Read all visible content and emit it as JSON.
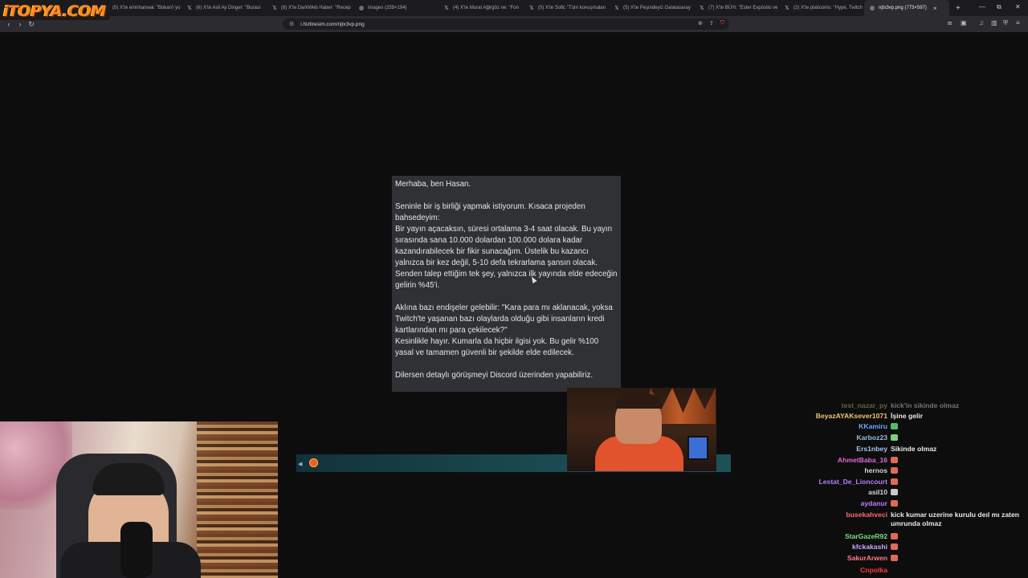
{
  "logo": {
    "text": "iTOPYA.COM"
  },
  "tabs": [
    {
      "label": "(5) X'te emirhanwai: \"Bokan'i yo",
      "icon": "x-logo-icon"
    },
    {
      "label": "(6) X'te Asli Ay Dinger: \"Burasi",
      "icon": "x-logo-icon"
    },
    {
      "label": "(6) X'te DarkWeb Haber: \"Recep",
      "icon": "x-logo-icon"
    },
    {
      "label": "images (259×194)",
      "icon": "globe-icon"
    },
    {
      "label": "(4) X'te Murat Ağirgöz ne: \"Fon",
      "icon": "x-logo-icon"
    },
    {
      "label": "(5) X'te Sofic \"Tüm konuşmaları",
      "icon": "x-logo-icon"
    },
    {
      "label": "(5) X'te Peşindeyiz Galatasaray",
      "icon": "x-logo-icon"
    },
    {
      "label": "(7) X'te BÜYi: \"Ester Expósito ve",
      "icon": "x-logo-icon"
    },
    {
      "label": "(2) X'te platicoms: \"Hype, Twitch",
      "icon": "x-logo-icon"
    },
    {
      "label": "njtx3vp.png (773×597)",
      "icon": "globe-icon",
      "active": true
    }
  ],
  "address": {
    "url": "i.hizliresim.com/njtx3vp.png"
  },
  "message_image": {
    "paragraphs": [
      "Merhaba, ben Hasan.",
      "Seninle bir iş birliği yapmak istiyorum. Kısaca projeden bahsedeyim:\nBir yayın açacaksın, süresi ortalama 3-4 saat olacak. Bu yayın sırasında sana 10.000 dolardan 100.000 dolara kadar kazandırabilecek bir fikir sunacağım. Üstelik bu kazancı yalnızca bir kez değil, 5-10 defa tekrarlama şansın olacak.\nSenden talep ettiğim tek şey, yalnızca ilk yayında elde edeceğin gelirin %45'i.",
      "Aklına bazı endişeler gelebilir: \"Kara para mı aklanacak, yoksa Twitch'te yaşanan bazı olaylarda olduğu gibi insanların kredi kartlarından mı para çekilecek?\"\nKesinlikle hayır. Kumarla da hiçbir ilgisi yok. Bu gelir %100 yasal ve tamamen güvenli bir şekilde elde edilecek.",
      "Dilersen detaylı görüşmeyi Discord üzerinden yapabiliriz."
    ]
  },
  "chat": [
    {
      "user": "test_nazar_py",
      "color": "#d6c27a",
      "msg": "kick'in sikinde olmaz"
    },
    {
      "user": "BeyazAYAKsever1071",
      "color": "#f0c674",
      "msg": "İşine gelir"
    },
    {
      "user": "KKamiru",
      "color": "#6ea8ff",
      "msg": "",
      "emote": "#4fbf6a"
    },
    {
      "user": "Karboz23",
      "color": "#9bb8d8",
      "msg": "",
      "emote": "#7bd07a"
    },
    {
      "user": "Ers1nbey",
      "color": "#a9c6e8",
      "msg": "Sikinde olmaz"
    },
    {
      "user": "AhmetBaba_16",
      "color": "#d96bd6",
      "msg": "",
      "emote": "#e06a5a"
    },
    {
      "user": "hernos",
      "color": "#d5d5d5",
      "msg": "",
      "emote": "#e06a5a"
    },
    {
      "user": "Lestat_De_Lioncourt",
      "color": "#b57cff",
      "msg": "",
      "emote": "#e06a5a"
    },
    {
      "user": "asil10",
      "color": "#d5d5d5",
      "msg": "",
      "emote": "#c9c9c9"
    },
    {
      "user": "aydanur",
      "color": "#c07cff",
      "msg": "",
      "emote": "#e06a5a"
    },
    {
      "user": "busekahveci",
      "color": "#ff6b6b",
      "msg": "kick kumar uzerine kurulu deıl mı zaten umrunda olmaz"
    },
    {
      "user": "StarGazeR92",
      "color": "#7ee07e",
      "msg": "",
      "emote": "#e06a5a"
    },
    {
      "user": "kfckakashi",
      "color": "#c8a8ff",
      "msg": "",
      "emote": "#e06a5a"
    },
    {
      "user": "SakurArwen",
      "color": "#ff7a8a",
      "msg": "",
      "emote": "#e06a5a"
    },
    {
      "user": "Cnpolka",
      "color": "#ff3b3b",
      "msg": ""
    }
  ]
}
